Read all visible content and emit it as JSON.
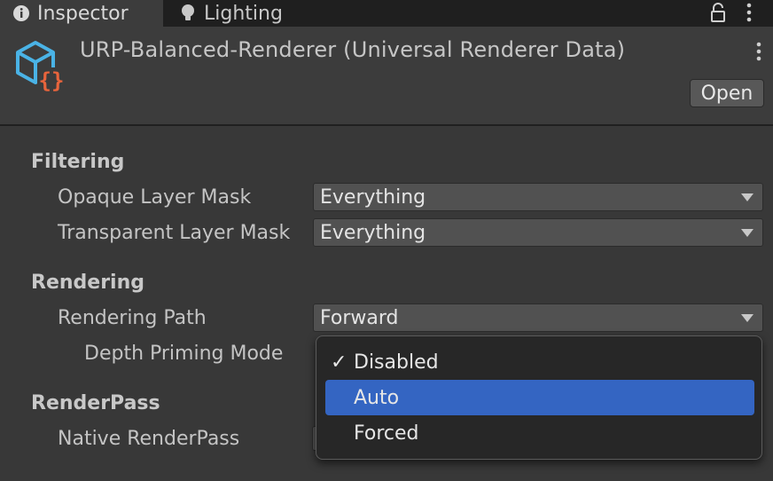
{
  "tabs": [
    {
      "label": "Inspector",
      "icon": "info-icon"
    },
    {
      "label": "Lighting",
      "icon": "lightbulb-icon"
    }
  ],
  "header": {
    "asset_title": "URP-Balanced-Renderer (Universal Renderer Data)",
    "open_label": "Open",
    "asset_icon": "scriptable-object-icon"
  },
  "filtering": {
    "title": "Filtering",
    "opaque_label": "Opaque Layer Mask",
    "opaque_value": "Everything",
    "transparent_label": "Transparent Layer Mask",
    "transparent_value": "Everything"
  },
  "rendering": {
    "title": "Rendering",
    "path_label": "Rendering Path",
    "path_value": "Forward",
    "depth_label": "Depth Priming Mode"
  },
  "renderpass": {
    "title": "RenderPass",
    "native_label": "Native RenderPass"
  },
  "dropdown": {
    "options": [
      {
        "label": "Disabled",
        "checked": true
      },
      {
        "label": "Auto",
        "highlighted": true
      },
      {
        "label": "Forced"
      }
    ],
    "check_mark": "✓"
  },
  "colors": {
    "background": "#383838",
    "header": "#3c3c3c",
    "tabbar": "#1f1f1f",
    "highlight": "#3465c2",
    "asset_icon_blue": "#4ab3e6",
    "asset_icon_orange": "#e8643c"
  }
}
